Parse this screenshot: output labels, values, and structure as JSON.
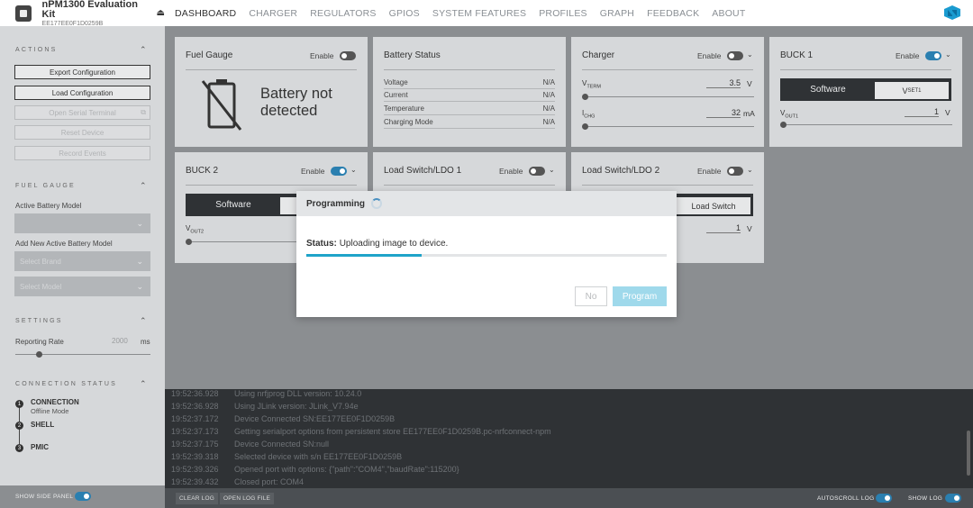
{
  "device": {
    "name": "nPM1300 Evaluation Kit",
    "serial": "EE177EE0F1D0259B",
    "eject_icon": "eject-icon"
  },
  "nav": {
    "tabs": [
      "DASHBOARD",
      "CHARGER",
      "REGULATORS",
      "GPIOS",
      "SYSTEM FEATURES",
      "PROFILES",
      "GRAPH",
      "FEEDBACK",
      "ABOUT"
    ],
    "active": "DASHBOARD"
  },
  "sidebar": {
    "actions": {
      "heading": "ACTIONS",
      "export": "Export Configuration",
      "load": "Load Configuration",
      "serial": "Open Serial Terminal",
      "reset": "Reset Device",
      "record": "Record Events"
    },
    "fuel_gauge": {
      "heading": "FUEL GAUGE",
      "active_label": "Active Battery Model",
      "active_value": "",
      "add_label": "Add New Active Battery Model",
      "brand_placeholder": "Select Brand",
      "model_placeholder": "Select Model"
    },
    "settings": {
      "heading": "SETTINGS",
      "rate_label": "Reporting Rate",
      "rate_value": "2000",
      "rate_unit": "ms"
    },
    "connection": {
      "heading": "CONNECTION STATUS",
      "steps": [
        {
          "num": "1",
          "title": "CONNECTION",
          "sub": "Offline Mode"
        },
        {
          "num": "2",
          "title": "SHELL",
          "sub": ""
        },
        {
          "num": "3",
          "title": "PMIC",
          "sub": ""
        }
      ]
    },
    "footer": {
      "show_side_panel": "SHOW SIDE PANEL",
      "show_side_panel_on": true
    }
  },
  "cards": {
    "fuel": {
      "title": "Fuel Gauge",
      "enable": "Enable",
      "enabled": false,
      "message": "Battery not detected",
      "icon": "battery-slash-icon"
    },
    "battery": {
      "title": "Battery Status",
      "rows": [
        {
          "k": "Voltage",
          "v": "N/A"
        },
        {
          "k": "Current",
          "v": "N/A"
        },
        {
          "k": "Temperature",
          "v": "N/A"
        },
        {
          "k": "Charging Mode",
          "v": "N/A"
        }
      ]
    },
    "charger": {
      "title": "Charger",
      "enable": "Enable",
      "enabled": false,
      "vterm_main": "V",
      "vterm_sub": "TERM",
      "vterm_value": "3.5",
      "vterm_unit": "V",
      "ichg_main": "I",
      "ichg_sub": "CHG",
      "ichg_value": "32",
      "ichg_unit": "mA"
    },
    "buck1": {
      "title": "BUCK 1",
      "enable": "Enable",
      "enabled": true,
      "mode_software": "Software",
      "mode_vset_main": "V",
      "mode_vset_sub": "SET1",
      "vout_main": "V",
      "vout_sub": "OUT1",
      "vout_value": "1",
      "vout_unit": "V"
    },
    "buck2": {
      "title": "BUCK 2",
      "enable": "Enable",
      "enabled": true,
      "mode_software": "Software",
      "vout_main": "V",
      "vout_sub": "OUT2"
    },
    "ldo1": {
      "title": "Load Switch/LDO 1",
      "enable": "Enable",
      "enabled": false
    },
    "ldo2": {
      "title": "Load Switch/LDO 2",
      "enable": "Enable",
      "enabled": false,
      "mode": "Load Switch",
      "value": "1",
      "unit": "V"
    }
  },
  "log": {
    "lines": [
      {
        "ts": "19:52:36.928",
        "msg": "Using nrfjprog DLL version: 10.24.0"
      },
      {
        "ts": "19:52:36.928",
        "msg": "Using JLink version: JLink_V7.94e"
      },
      {
        "ts": "19:52:37.172",
        "msg": "Device Connected SN:EE177EE0F1D0259B"
      },
      {
        "ts": "19:52:37.173",
        "msg": "Getting serialport options from persistent store EE177EE0F1D0259B.pc-nrfconnect-npm"
      },
      {
        "ts": "19:52:37.175",
        "msg": "Device Connected SN:null"
      },
      {
        "ts": "19:52:39.318",
        "msg": "Selected device with s/n EE177EE0F1D0259B"
      },
      {
        "ts": "19:52:39.326",
        "msg": "Opened port with options: {\"path\":\"COM4\",\"baudRate\":115200}"
      },
      {
        "ts": "19:52:39.432",
        "msg": "Closed port: COM4"
      }
    ],
    "clear": "CLEAR LOG",
    "open": "OPEN LOG FILE",
    "autoscroll": "AUTOSCROLL LOG",
    "autoscroll_on": true,
    "show": "SHOW LOG",
    "show_on": true
  },
  "modal": {
    "title": "Programming",
    "status_label": "Status:",
    "status_text": "Uploading image to device.",
    "progress": 0.32,
    "no": "No",
    "program": "Program"
  },
  "colors": {
    "accent": "#1fa3c9",
    "toggle_on": "#2a7fb0",
    "dark": "#2f3235"
  }
}
